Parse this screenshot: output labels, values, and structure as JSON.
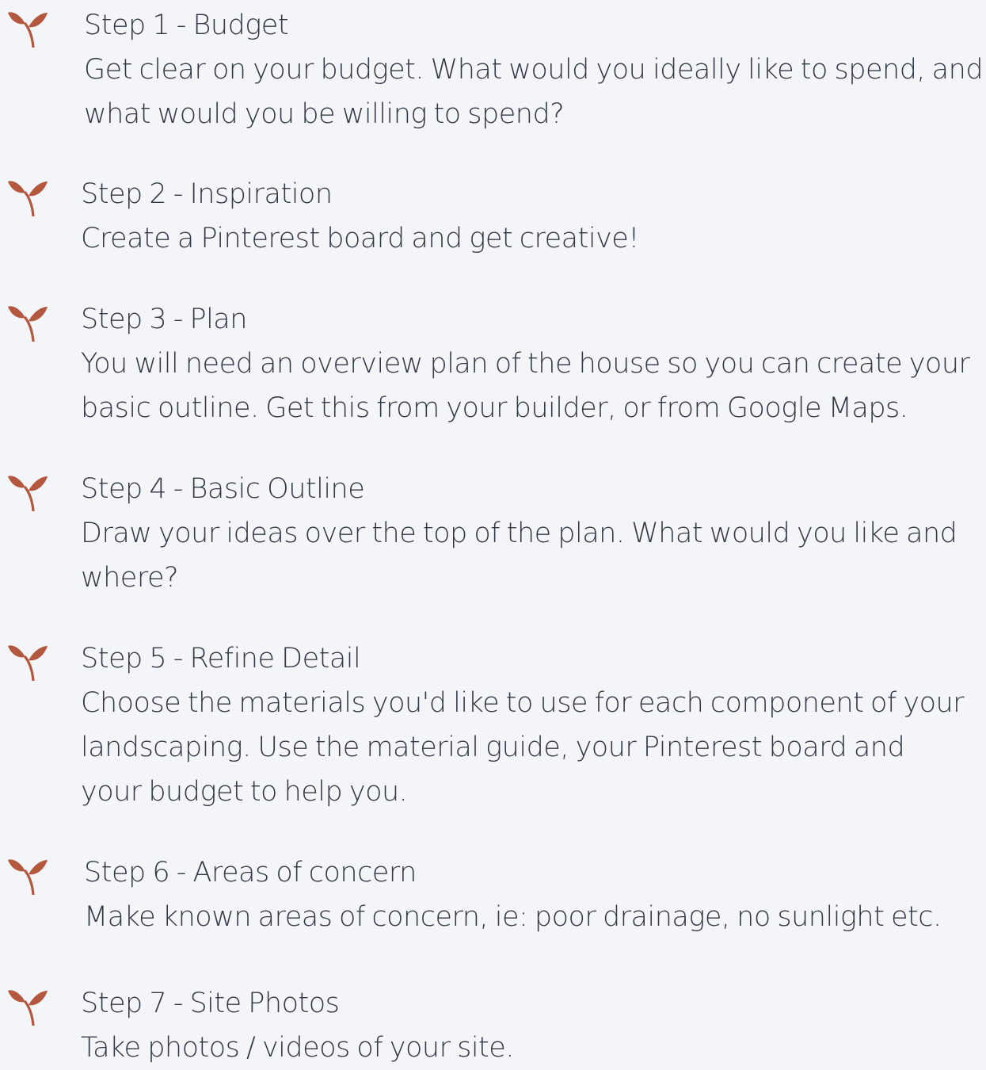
{
  "icon": "sprout-icon",
  "icon_color": "#b3583f",
  "steps": [
    {
      "title": "Step 1 - Budget",
      "lines": [
        "Get clear on your budget. What would you ideally like to spend, and",
        "what would you be willing to spend?"
      ]
    },
    {
      "title": "Step 2 - Inspiration",
      "lines": [
        "Create a Pinterest board and get creative!"
      ]
    },
    {
      "title": "Step 3 - Plan",
      "lines": [
        "You will need an overview plan of the house so you can create your",
        "basic outline. Get this from your builder, or from Google Maps."
      ]
    },
    {
      "title": "Step 4 - Basic Outline",
      "lines": [
        "Draw your ideas over the top of the plan. What would you like and",
        "where?"
      ]
    },
    {
      "title": "Step 5 - Refine Detail",
      "lines": [
        "Choose the materials you'd like to use for each component of your",
        "landscaping. Use the material guide, your Pinterest board and",
        "your budget to help you."
      ]
    },
    {
      "title": "Step 6 - Areas of concern",
      "lines": [
        "Make known areas of concern, ie: poor drainage, no sunlight etc."
      ]
    },
    {
      "title": "Step 7 - Site Photos",
      "lines": [
        "Take photos / videos of your site."
      ]
    }
  ]
}
